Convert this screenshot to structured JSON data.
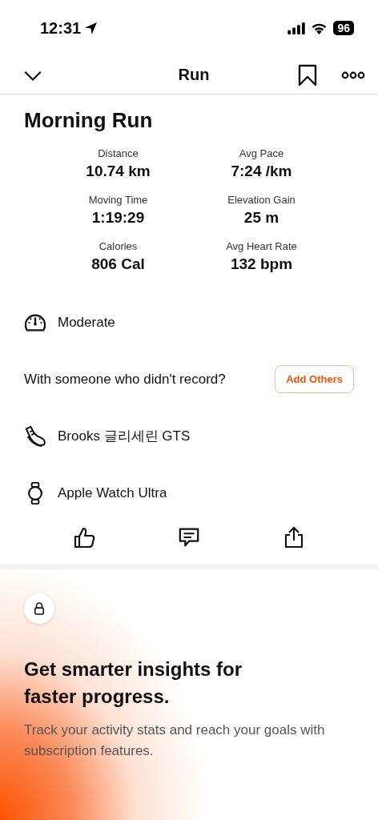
{
  "status_bar": {
    "time": "12:31",
    "battery": "96"
  },
  "nav": {
    "title": "Run"
  },
  "activity": {
    "title": "Morning Run",
    "stats": [
      {
        "label": "Distance",
        "value": "10.74 km"
      },
      {
        "label": "Avg Pace",
        "value": "7:24 /km"
      },
      {
        "label": "Moving Time",
        "value": "1:19:29"
      },
      {
        "label": "Elevation Gain",
        "value": "25 m"
      },
      {
        "label": "Calories",
        "value": "806 Cal"
      },
      {
        "label": "Avg Heart Rate",
        "value": "132 bpm"
      }
    ]
  },
  "details": [
    {
      "kind": "effort",
      "text": "Moderate"
    },
    {
      "kind": "prompt",
      "text": "With someone who didn't record?",
      "button": "Add Others"
    },
    {
      "kind": "shoe",
      "text": "Brooks 글리세린 GTS"
    },
    {
      "kind": "watch",
      "text": "Apple Watch Ultra"
    }
  ],
  "promo": {
    "title": "Get smarter insights for faster progress.",
    "body": "Track your activity stats and reach your goals with subscription features."
  }
}
